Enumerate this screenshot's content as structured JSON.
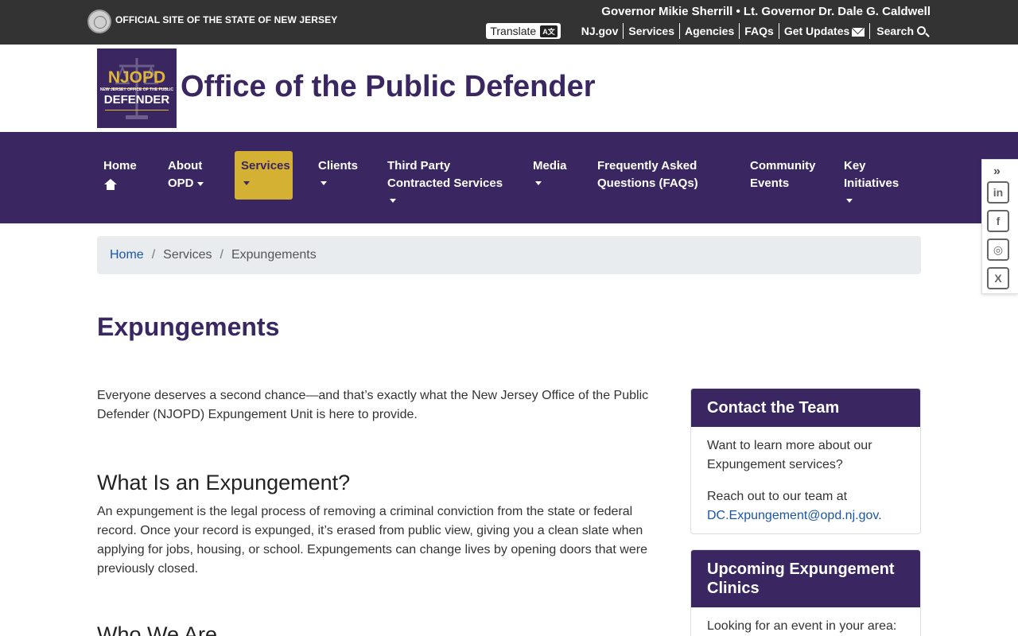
{
  "topbar": {
    "official": "OFFICIAL SITE OF THE STATE OF NEW JERSEY",
    "governor": "Governor Mikie Sherrill • Lt. Governor Dr. Dale G. Caldwell",
    "translate": "Translate",
    "links": [
      "NJ.gov",
      "Services",
      "Agencies",
      "FAQs",
      "Get Updates",
      "Search"
    ]
  },
  "header": {
    "logo": {
      "line1": "NJOPD",
      "line2": "NEW JERSEY OFFICE OF THE PUBLIC",
      "line3": "DEFENDER"
    },
    "title": "Office of the Public Defender"
  },
  "nav": {
    "home": "Home",
    "about": [
      "About",
      "OPD"
    ],
    "services": "Services",
    "clients": "Clients",
    "third_party": [
      "Third Party",
      "Contracted Services"
    ],
    "media": "Media",
    "faqs": [
      "Frequently Asked",
      "Questions (FAQs)"
    ],
    "community": [
      "Community",
      "Events"
    ],
    "key": [
      "Key",
      "Initiatives"
    ]
  },
  "social": {
    "collapse": "»",
    "items": [
      "in",
      "f",
      "◎",
      "X"
    ]
  },
  "breadcrumb": {
    "home": "Home",
    "services": "Services",
    "current": "Expungements"
  },
  "page": {
    "title": "Expungements",
    "intro": "Everyone deserves a second chance—and that’s exactly what the New Jersey Office of the Public Defender (NJOPD) Expungement Unit is here to provide.",
    "h2a": "What Is an Expungement?",
    "para2": "An expungement is the legal process of removing a criminal conviction from the state or federal record. Once your record is expunged, it’s erased from public view, giving you a clean slate when applying for jobs, housing, or school. Expungements can change lives by opening doors that were previously closed.",
    "h2b": "Who We Are"
  },
  "sidebar": {
    "contact": {
      "title": "Contact the Team",
      "text1": "Want to learn more about our Expungement services?",
      "text2": "Reach out to our team at",
      "email": "DC.Expungement@opd.nj.gov",
      "period": "."
    },
    "clinics": {
      "title": "Upcoming Expungement Clinics",
      "text": "Looking for an event in your area:"
    }
  },
  "colors": {
    "purple": "#3a2762",
    "gold": "#d4b033",
    "topbar": "#333333",
    "link": "#1a56a8"
  }
}
